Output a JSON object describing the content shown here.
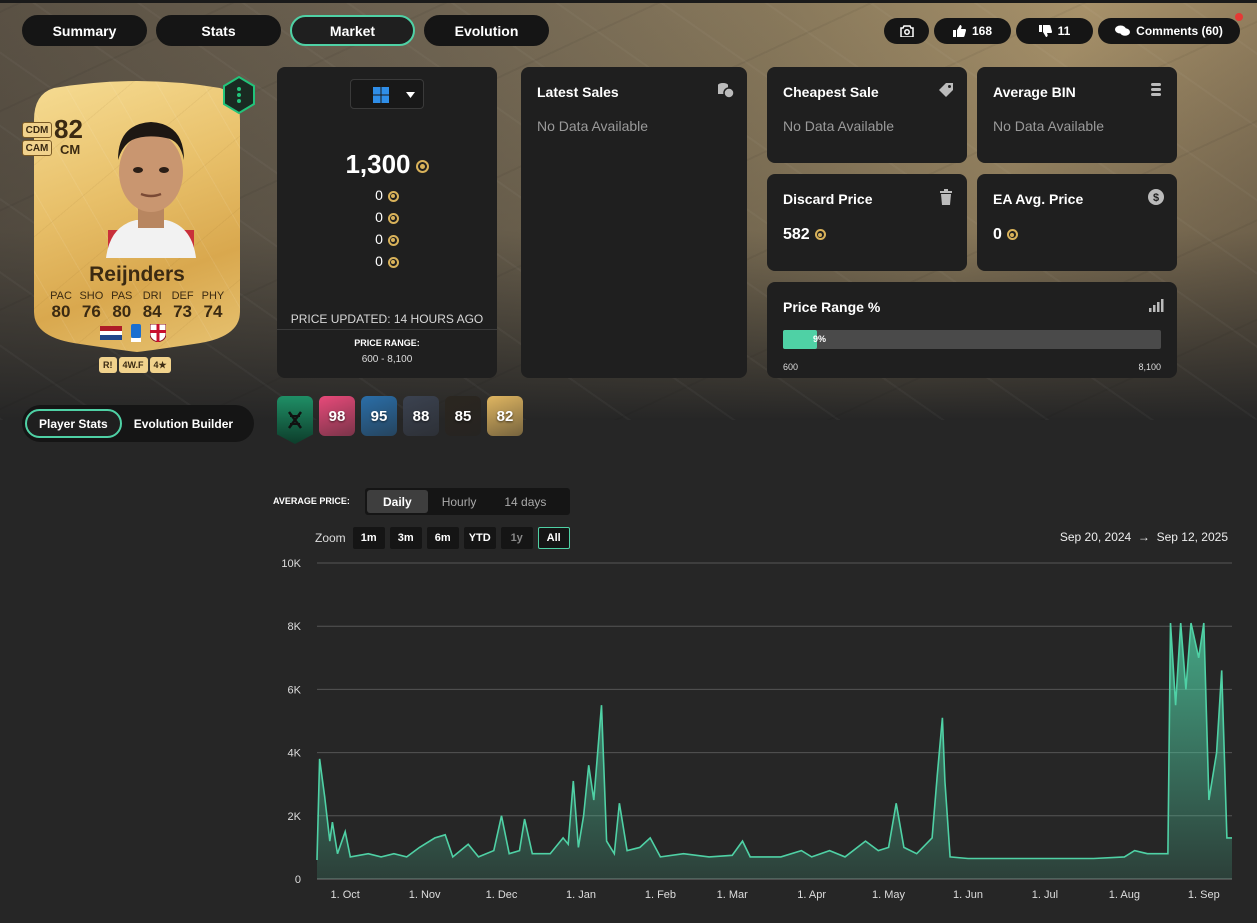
{
  "tabs": [
    "Summary",
    "Stats",
    "Market",
    "Evolution"
  ],
  "active_tab": "Market",
  "top_actions": {
    "likes": "168",
    "dislikes": "11",
    "comments": "Comments (60)"
  },
  "card": {
    "rating": "82",
    "position": "CM",
    "alt_positions": [
      "CDM",
      "CAM"
    ],
    "name": "Reijnders",
    "stat_labels": [
      "PAC",
      "SHO",
      "PAS",
      "DRI",
      "DEF",
      "PHY"
    ],
    "stat_values": [
      "80",
      "76",
      "80",
      "84",
      "73",
      "74"
    ],
    "badges": [
      "R!",
      "4W.F",
      "4★"
    ]
  },
  "toggle": {
    "on": "Player Stats",
    "off": "Evolution Builder"
  },
  "price": {
    "main": "1,300",
    "others": [
      "0",
      "0",
      "0",
      "0"
    ],
    "updated": "PRICE UPDATED: 14 HOURS AGO",
    "range_label": "PRICE RANGE:",
    "range_value": "600 - 8,100"
  },
  "latest_sales": {
    "title": "Latest Sales",
    "value": "No Data Available"
  },
  "cheapest_sale": {
    "title": "Cheapest Sale",
    "value": "No Data Available"
  },
  "average_bin": {
    "title": "Average BIN",
    "value": "No Data Available"
  },
  "discard_price": {
    "title": "Discard Price",
    "value": "582"
  },
  "ea_avg_price": {
    "title": "EA Avg. Price",
    "value": "0"
  },
  "price_range": {
    "title": "Price Range %",
    "percent_label": "9%",
    "fraction": 0.09,
    "min": "600",
    "max": "8,100"
  },
  "versions": [
    {
      "rating": "",
      "color": "#1f8f66"
    },
    {
      "rating": "98",
      "color": "#e84a7a"
    },
    {
      "rating": "95",
      "color": "#2a6ea8"
    },
    {
      "rating": "88",
      "color": "#3b4250"
    },
    {
      "rating": "85",
      "color": "#2b2620"
    },
    {
      "rating": "82",
      "color": "#e0b661"
    }
  ],
  "avg_price_label": "AVERAGE PRICE:",
  "periods": [
    "Daily",
    "Hourly",
    "14 days"
  ],
  "active_period": "Daily",
  "zoom": {
    "label": "Zoom",
    "buttons": [
      "1m",
      "3m",
      "6m",
      "YTD",
      "1y",
      "All"
    ],
    "selected": "All",
    "disabled": [
      "1y"
    ]
  },
  "date_range": {
    "from": "Sep 20, 2024",
    "to": "Sep 12, 2025"
  },
  "colors": {
    "accent": "#4fd1a5"
  },
  "chart_data": {
    "type": "area",
    "ylim": [
      0,
      10000
    ],
    "yticks": [
      "0",
      "2K",
      "4K",
      "6K",
      "8K",
      "10K"
    ],
    "xticks": [
      "1. Oct",
      "1. Nov",
      "1. Dec",
      "1. Jan",
      "1. Feb",
      "1. Mar",
      "1. Apr",
      "1. May",
      "1. Jun",
      "1. Jul",
      "1. Aug",
      "1. Sep"
    ],
    "x_start": "2024-09-20",
    "x_end": "2025-09-12",
    "series": [
      {
        "points": [
          [
            "2024-09-20",
            600
          ],
          [
            "2024-09-21",
            3800
          ],
          [
            "2024-09-23",
            2600
          ],
          [
            "2024-09-25",
            1200
          ],
          [
            "2024-09-26",
            1800
          ],
          [
            "2024-09-28",
            800
          ],
          [
            "2024-10-01",
            1500
          ],
          [
            "2024-10-03",
            700
          ],
          [
            "2024-10-10",
            800
          ],
          [
            "2024-10-15",
            700
          ],
          [
            "2024-10-20",
            800
          ],
          [
            "2024-10-25",
            700
          ],
          [
            "2024-10-30",
            1000
          ],
          [
            "2024-11-05",
            1300
          ],
          [
            "2024-11-09",
            1400
          ],
          [
            "2024-11-12",
            700
          ],
          [
            "2024-11-18",
            1100
          ],
          [
            "2024-11-22",
            700
          ],
          [
            "2024-11-28",
            900
          ],
          [
            "2024-12-01",
            2000
          ],
          [
            "2024-12-04",
            800
          ],
          [
            "2024-12-08",
            900
          ],
          [
            "2024-12-10",
            1900
          ],
          [
            "2024-12-13",
            800
          ],
          [
            "2024-12-20",
            800
          ],
          [
            "2024-12-25",
            1300
          ],
          [
            "2024-12-27",
            1100
          ],
          [
            "2024-12-29",
            3100
          ],
          [
            "2024-12-31",
            1000
          ],
          [
            "2025-01-02",
            2000
          ],
          [
            "2025-01-04",
            3600
          ],
          [
            "2025-01-06",
            2500
          ],
          [
            "2025-01-09",
            5500
          ],
          [
            "2025-01-11",
            1200
          ],
          [
            "2025-01-14",
            800
          ],
          [
            "2025-01-16",
            2400
          ],
          [
            "2025-01-19",
            900
          ],
          [
            "2025-01-24",
            1000
          ],
          [
            "2025-01-28",
            1300
          ],
          [
            "2025-02-01",
            700
          ],
          [
            "2025-02-10",
            800
          ],
          [
            "2025-02-20",
            700
          ],
          [
            "2025-03-01",
            750
          ],
          [
            "2025-03-05",
            1200
          ],
          [
            "2025-03-08",
            700
          ],
          [
            "2025-03-20",
            700
          ],
          [
            "2025-03-28",
            900
          ],
          [
            "2025-04-01",
            700
          ],
          [
            "2025-04-08",
            900
          ],
          [
            "2025-04-14",
            700
          ],
          [
            "2025-04-22",
            1200
          ],
          [
            "2025-04-27",
            900
          ],
          [
            "2025-05-01",
            1000
          ],
          [
            "2025-05-04",
            2400
          ],
          [
            "2025-05-07",
            1000
          ],
          [
            "2025-05-12",
            800
          ],
          [
            "2025-05-18",
            1300
          ],
          [
            "2025-05-20",
            3300
          ],
          [
            "2025-05-22",
            5100
          ],
          [
            "2025-05-23",
            3100
          ],
          [
            "2025-05-25",
            700
          ],
          [
            "2025-06-01",
            650
          ],
          [
            "2025-06-15",
            650
          ],
          [
            "2025-07-01",
            650
          ],
          [
            "2025-07-20",
            650
          ],
          [
            "2025-08-01",
            700
          ],
          [
            "2025-08-05",
            900
          ],
          [
            "2025-08-10",
            800
          ],
          [
            "2025-08-18",
            800
          ],
          [
            "2025-08-19",
            8100
          ],
          [
            "2025-08-21",
            5500
          ],
          [
            "2025-08-23",
            8100
          ],
          [
            "2025-08-25",
            6000
          ],
          [
            "2025-08-27",
            8100
          ],
          [
            "2025-08-30",
            7000
          ],
          [
            "2025-09-01",
            8100
          ],
          [
            "2025-09-03",
            2500
          ],
          [
            "2025-09-06",
            4000
          ],
          [
            "2025-09-08",
            6600
          ],
          [
            "2025-09-10",
            1300
          ],
          [
            "2025-09-12",
            1300
          ]
        ]
      }
    ]
  }
}
